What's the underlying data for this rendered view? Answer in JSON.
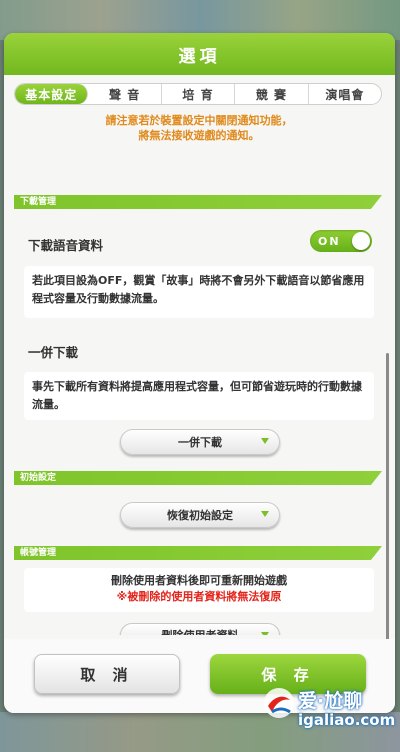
{
  "dialog": {
    "title": "選項"
  },
  "tabs": [
    {
      "label": "基本設定",
      "active": true
    },
    {
      "label": "聲 音",
      "active": false
    },
    {
      "label": "培 育",
      "active": false
    },
    {
      "label": "競 賽",
      "active": false
    },
    {
      "label": "演唱會",
      "active": false
    }
  ],
  "notice": {
    "line1": "請注意若於裝置設定中關閉通知功能，",
    "line2": "將無法接收遊戲的通知。"
  },
  "download_section": {
    "header": "下載管理",
    "voice_title": "下載語音資料",
    "voice_toggle": "ON",
    "voice_desc": "若此項目設為OFF，觀賞「故事」時將不會另外下載語音以節省應用程式容量及行動數據流量。",
    "bulk_title": "一併下載",
    "bulk_desc": "事先下載所有資料將提高應用程式容量，但可節省遊玩時的行動數據流量。",
    "bulk_button": "一併下載"
  },
  "reset_section": {
    "header": "初始設定",
    "reset_button": "恢復初始設定"
  },
  "account_section": {
    "header": "帳號管理",
    "warn_line1": "刪除使用者資料後即可重新開始遊戲",
    "warn_line2": "※被刪除的使用者資料將無法復原",
    "delete_button": "刪除使用者資料"
  },
  "footer": {
    "cancel_label": "取 消",
    "save_label": "保 存"
  },
  "watermark": {
    "brand": "爱·尬聊",
    "url": "igaliao.com"
  },
  "colors": {
    "accent_green": "#72b81f",
    "notice_orange": "#e08a1c",
    "warning_red": "#e3241b"
  }
}
